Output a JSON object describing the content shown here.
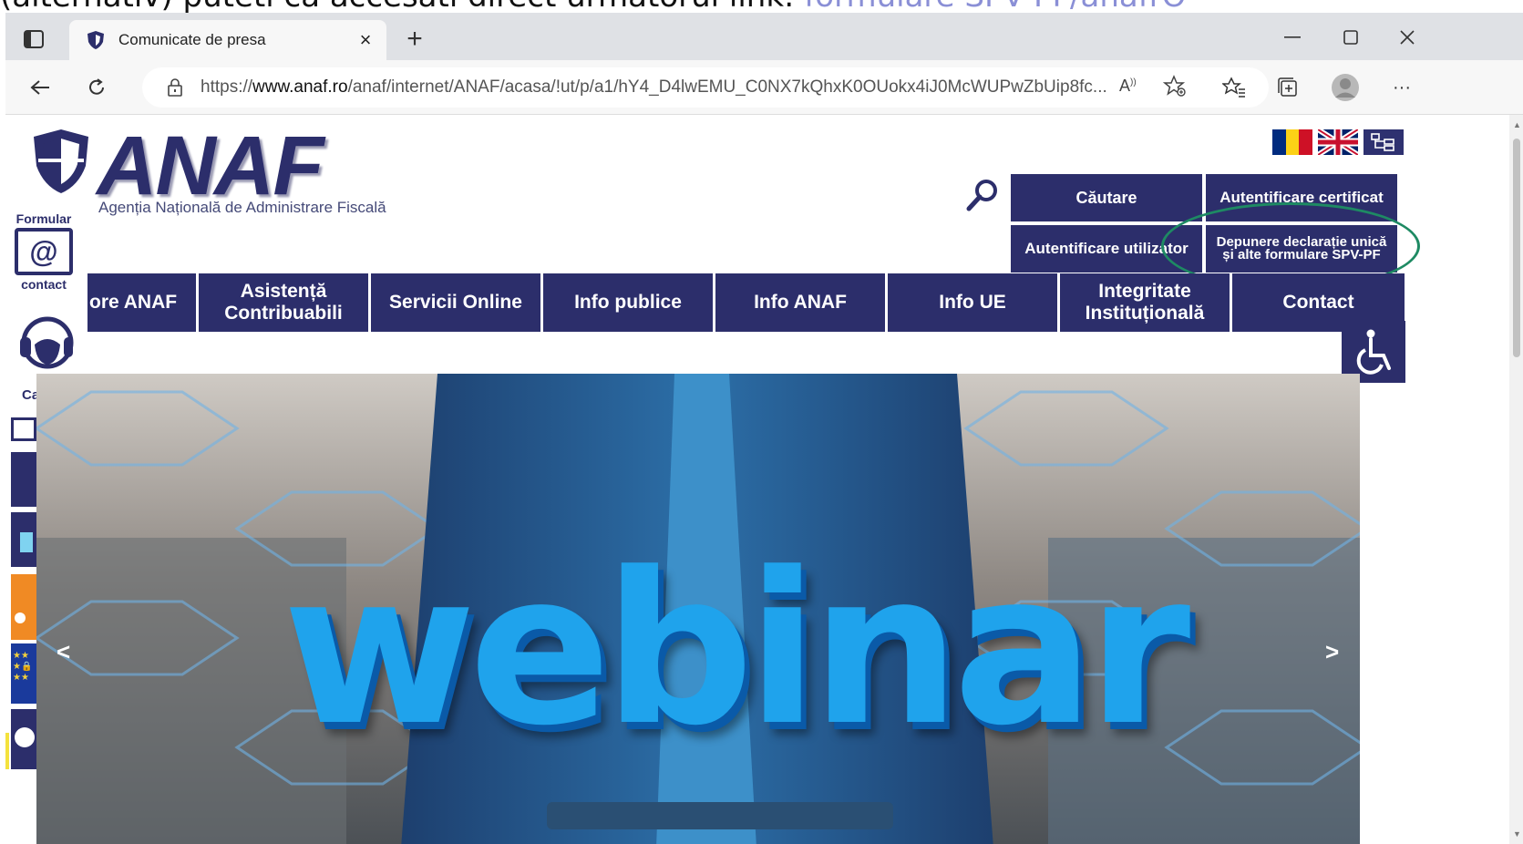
{
  "caption": {
    "text": "(alternativ) puteti ca accesati direct urmatorul link: ",
    "link": "formulare SPV-PF/anafrO"
  },
  "browser": {
    "tab_title": "Comunicate de presa",
    "url_prefix": "https://",
    "url_host": "www.anaf.ro",
    "url_path": "/anaf/internet/ANAF/acasa/!ut/p/a1/hY4_D4lwEMU_C0NX7kQhxK0OUokx4iJ0McWUPwZbUip8fc...",
    "new_tab": "+",
    "close_tab": "×",
    "more": "···"
  },
  "site": {
    "brand": "ANAF",
    "subtitle": "Agenția Națională de Administrare Fiscală",
    "side_formular_top": "Formular",
    "side_formular_bottom": "contact",
    "side_call": "Cal",
    "buttons": {
      "search": "Căutare",
      "cert": "Autentificare certificat",
      "user": "Autentificare utilizator",
      "spv_line1": "Depunere declarație unică",
      "spv_line2": "și alte formulare SPV-PF"
    },
    "nav": [
      {
        "label": "ore ANAF",
        "w": 0
      },
      {
        "label": "Asistență Contribuabili"
      },
      {
        "label": "Servicii Online"
      },
      {
        "label": "Info publice"
      },
      {
        "label": "Info ANAF"
      },
      {
        "label": "Info UE"
      },
      {
        "label": "Integritate Instituțională"
      },
      {
        "label": "Contact"
      }
    ],
    "hero_text": "webinar",
    "hero_prev": "<",
    "hero_next": ">"
  },
  "colors": {
    "brand_navy": "#2c2e6b",
    "highlight_green": "#1e8a63",
    "hero_blue": "#1fa3ec"
  }
}
